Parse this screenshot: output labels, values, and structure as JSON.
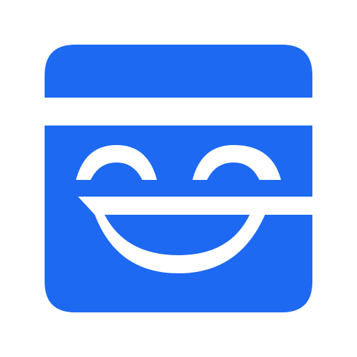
{
  "logo": {
    "icon": "smiling-face-app-icon",
    "colors": {
      "tile": "#1e69f2",
      "cutout": "#ffffff",
      "background": "#ffffff"
    }
  }
}
